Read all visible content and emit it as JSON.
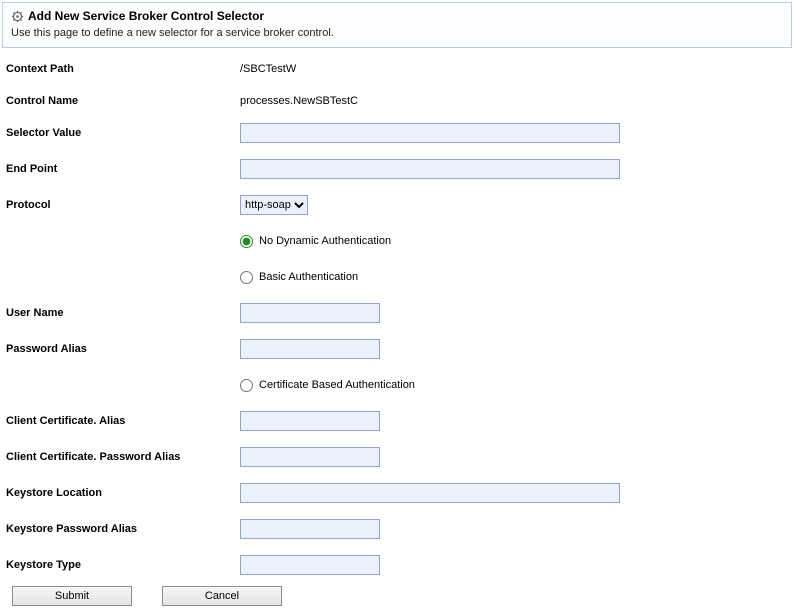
{
  "header": {
    "title": "Add New Service Broker Control Selector",
    "description": "Use this page to define a new selector for a service broker control."
  },
  "fields": {
    "context_path": {
      "label": "Context Path",
      "value": "/SBCTestW"
    },
    "control_name": {
      "label": "Control Name",
      "value": "processes.NewSBTestC"
    },
    "selector_value": {
      "label": "Selector Value",
      "value": ""
    },
    "end_point": {
      "label": "End Point",
      "value": ""
    },
    "protocol": {
      "label": "Protocol",
      "selected": "http-soap"
    },
    "auth": {
      "no_dynamic": "No Dynamic Authentication",
      "basic": "Basic Authentication",
      "cert": "Certificate Based Authentication"
    },
    "user_name": {
      "label": "User Name",
      "value": ""
    },
    "password_alias": {
      "label": "Password Alias",
      "value": ""
    },
    "client_cert_alias": {
      "label": "Client Certificate. Alias",
      "value": ""
    },
    "client_cert_pw_alias": {
      "label": "Client Certificate. Password Alias",
      "value": ""
    },
    "keystore_location": {
      "label": "Keystore Location",
      "value": ""
    },
    "keystore_pw_alias": {
      "label": "Keystore Password Alias",
      "value": ""
    },
    "keystore_type": {
      "label": "Keystore Type",
      "value": ""
    }
  },
  "buttons": {
    "submit": "Submit",
    "cancel": "Cancel"
  }
}
